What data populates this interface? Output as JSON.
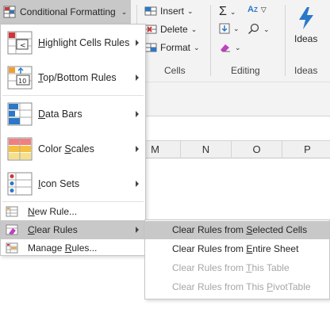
{
  "colors": {
    "accent_blue": "#2b78c9",
    "menu_highlight": "#c8c8c8",
    "disabled_text": "#a6a6a6"
  },
  "ribbon": {
    "conditional_formatting": "Conditional Formatting",
    "cells": {
      "insert": "Insert",
      "delete": "Delete",
      "format": "Format",
      "group_label": "Cells"
    },
    "editing": {
      "group_label": "Editing"
    },
    "ideas": {
      "button_label": "Ideas",
      "group_label": "Ideas"
    }
  },
  "grid": {
    "columns": [
      "M",
      "N",
      "O",
      "P"
    ]
  },
  "menu": {
    "items": [
      {
        "label": "Highlight Cells Rules",
        "icon": "highlight-cells-icon",
        "has_submenu": true
      },
      {
        "label": "Top/Bottom Rules",
        "icon": "top-bottom-icon",
        "has_submenu": true
      },
      {
        "label": "Data Bars",
        "icon": "data-bars-icon",
        "has_submenu": true
      },
      {
        "label": "Color Scales",
        "icon": "color-scales-icon",
        "has_submenu": true
      },
      {
        "label": "Icon Sets",
        "icon": "icon-sets-icon",
        "has_submenu": true
      }
    ],
    "new_rule": "New Rule...",
    "clear_rules": "Clear Rules",
    "manage_rules": "Manage Rules..."
  },
  "submenu": {
    "items": [
      {
        "label": "Clear Rules from Selected Cells",
        "enabled": true,
        "highlighted": true
      },
      {
        "label": "Clear Rules from Entire Sheet",
        "enabled": true,
        "highlighted": false
      },
      {
        "label": "Clear Rules from This Table",
        "enabled": false,
        "highlighted": false
      },
      {
        "label": "Clear Rules from This PivotTable",
        "enabled": false,
        "highlighted": false
      }
    ]
  }
}
